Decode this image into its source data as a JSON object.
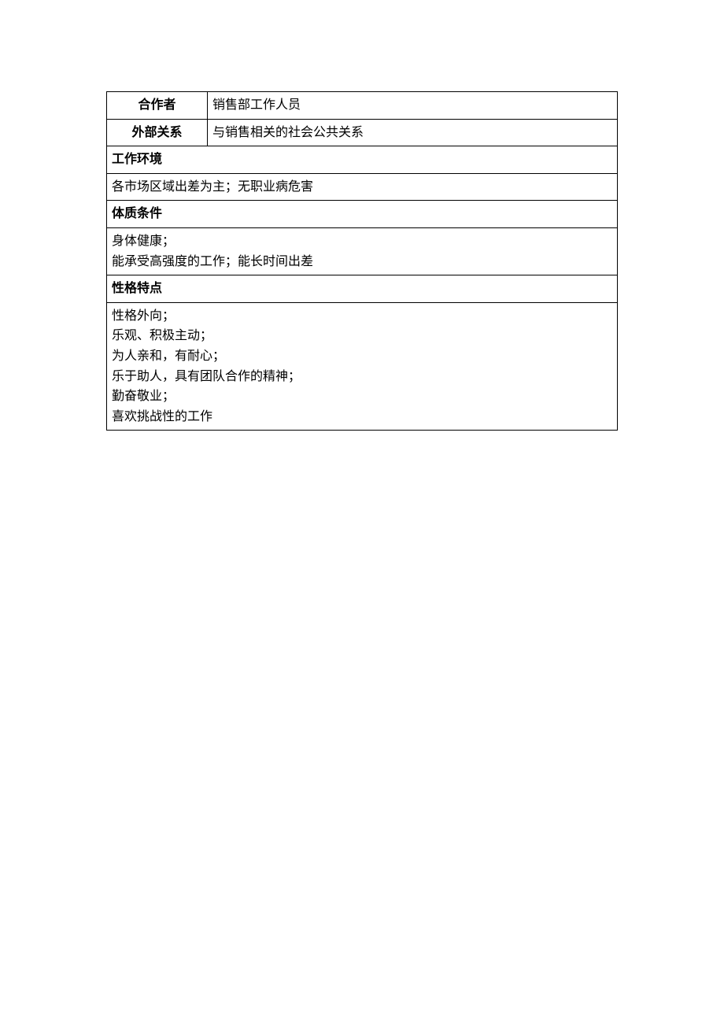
{
  "rows": {
    "cooperator": {
      "label": "合作者",
      "value": "销售部工作人员"
    },
    "external": {
      "label": "外部关系",
      "value": "与销售相关的社会公共关系"
    }
  },
  "sections": {
    "workenv": {
      "header": "工作环境",
      "lines": [
        "各市场区域出差为主；无职业病危害"
      ]
    },
    "physical": {
      "header": "体质条件",
      "lines": [
        "身体健康；",
        "能承受高强度的工作；能长时间出差"
      ]
    },
    "personality": {
      "header": "性格特点",
      "lines": [
        "性格外向；",
        "乐观、积极主动；",
        "为人亲和，有耐心；",
        "乐于助人，具有团队合作的精神；",
        "勤奋敬业；",
        "喜欢挑战性的工作"
      ]
    }
  }
}
